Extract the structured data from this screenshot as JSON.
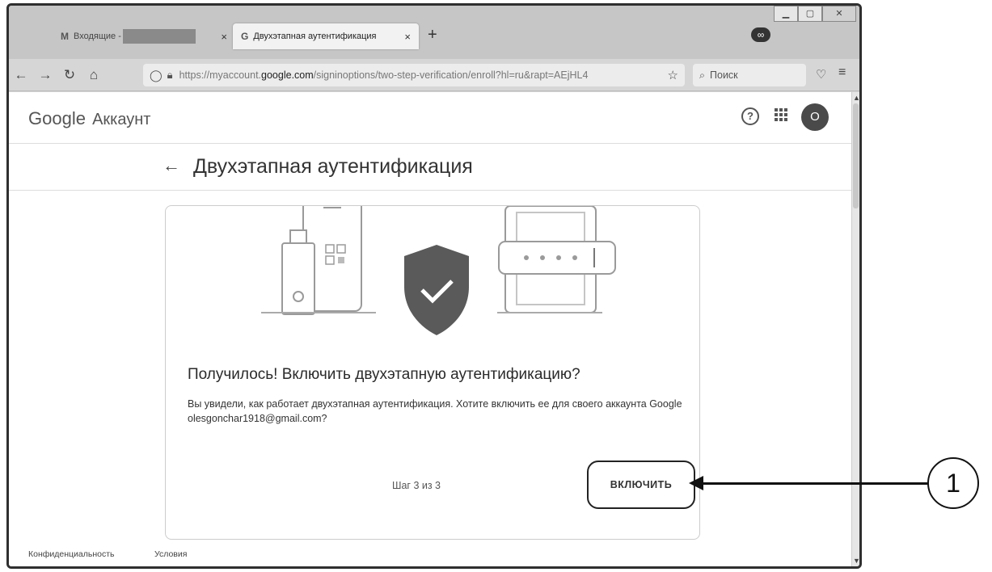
{
  "browser": {
    "tabs": [
      {
        "title": "Входящие -",
        "active": false,
        "icon": "gmail-icon"
      },
      {
        "title": "Двухэтапная аутентификация",
        "active": true,
        "icon": "google-g-icon",
        "favicon_letter": "G"
      }
    ],
    "url_prefix": "https://myaccount.",
    "url_domain": "google.com",
    "url_suffix": "/signinoptions/two-step-verification/enroll?hl=ru&rapt=AEjHL4",
    "search_placeholder": "Поиск",
    "close_symbol": "×",
    "new_tab_symbol": "+"
  },
  "header": {
    "logo_google": "Google",
    "logo_product": "Аккаунт",
    "help_symbol": "?",
    "apps_symbol": "⠿",
    "avatar_letter": "O"
  },
  "page": {
    "back_symbol": "←",
    "title": "Двухэтапная аутентификация"
  },
  "card": {
    "heading": "Получилось! Включить двухэтапную аутентификацию?",
    "description": "Вы увидели, как работает двухэтапная аутентификация. Хотите включить ее для своего аккаунта Google olesgonchar1918@gmail.com?",
    "step": "Шаг 3 из 3",
    "enable_button": "ВКЛЮЧИТЬ"
  },
  "footer": {
    "privacy": "Конфиденциальность",
    "terms": "Условия"
  },
  "annotation": {
    "label": "1"
  },
  "colors": {
    "shield": "#5a5a5a",
    "text": "#333333"
  }
}
